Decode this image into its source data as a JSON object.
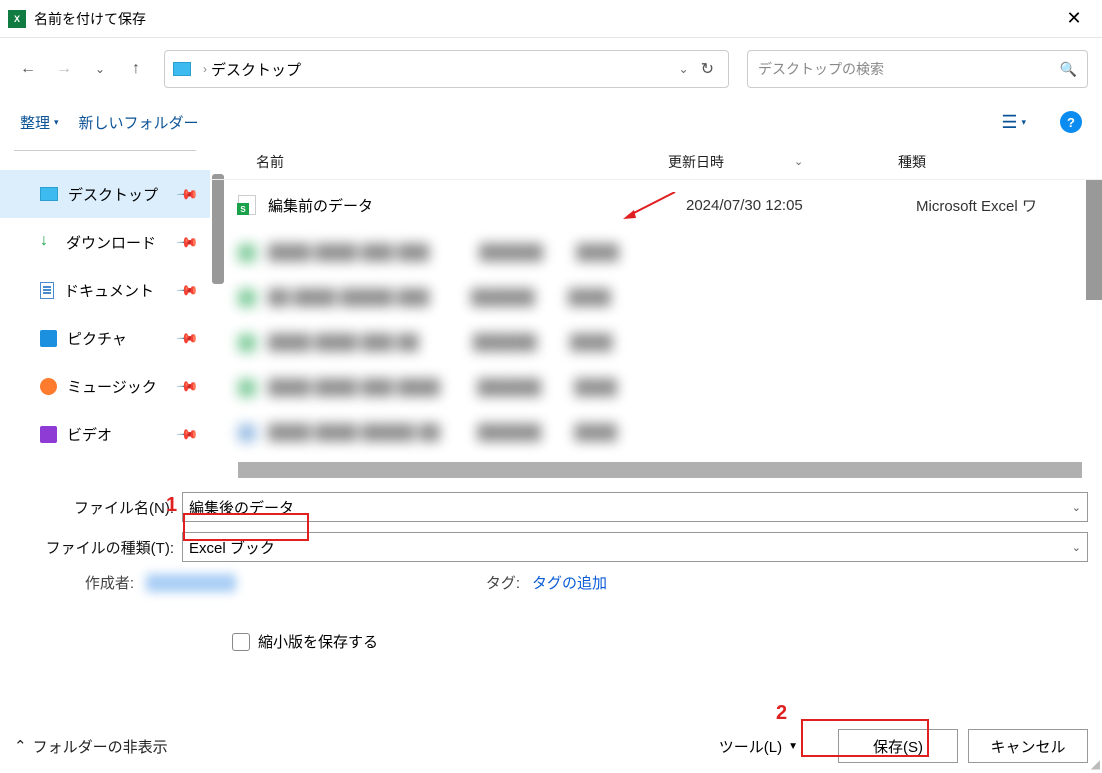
{
  "title": "名前を付けて保存",
  "app_icon_text": "X",
  "nav": {
    "address_current": "デスクトップ"
  },
  "search": {
    "placeholder": "デスクトップの検索"
  },
  "toolbar": {
    "organize": "整理",
    "new_folder": "新しいフォルダー"
  },
  "sidebar": {
    "items": [
      {
        "label": "デスクトップ",
        "icon": "desktop",
        "selected": true
      },
      {
        "label": "ダウンロード",
        "icon": "dl"
      },
      {
        "label": "ドキュメント",
        "icon": "doc"
      },
      {
        "label": "ピクチャ",
        "icon": "pic"
      },
      {
        "label": "ミュージック",
        "icon": "mus"
      },
      {
        "label": "ビデオ",
        "icon": "vid"
      }
    ]
  },
  "headers": {
    "name": "名前",
    "date": "更新日時",
    "type": "種類"
  },
  "files": [
    {
      "name": "編集前のデータ",
      "date": "2024/07/30 12:05",
      "type": "Microsoft Excel ワ"
    }
  ],
  "form": {
    "filename_label": "ファイル名(N):",
    "filename_value": "編集後のデータ",
    "filetype_label": "ファイルの種類(T):",
    "filetype_value": "Excel ブック",
    "author_label": "作成者:",
    "tags_label": "タグ:",
    "tags_value": "タグの追加",
    "thumb_label": "縮小版を保存する"
  },
  "footer": {
    "hide_folders": "フォルダーの非表示",
    "tools": "ツール(L)",
    "save": "保存(S)",
    "cancel": "キャンセル"
  },
  "annotations": {
    "num1": "1",
    "num2": "2"
  }
}
